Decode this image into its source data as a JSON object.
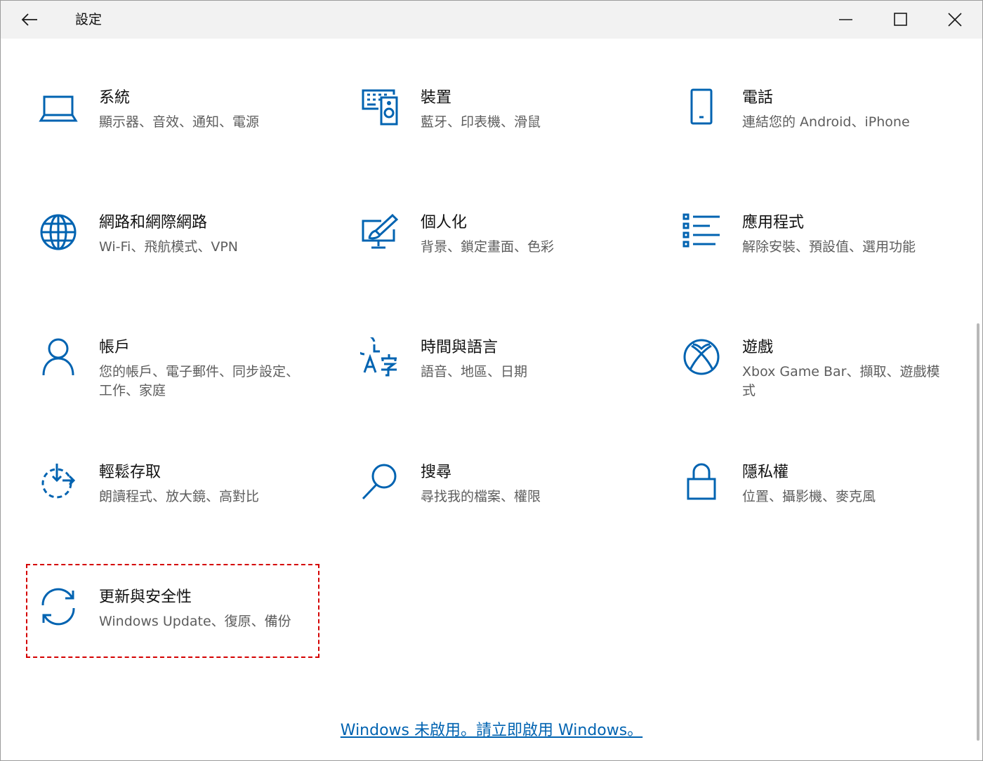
{
  "window": {
    "title": "設定",
    "accent_color": "#0063b1"
  },
  "titlebar": {
    "back_icon": "arrow-left-icon",
    "minimize_icon": "minimize-icon",
    "maximize_icon": "maximize-icon",
    "close_icon": "close-icon"
  },
  "categories": [
    {
      "title": "系統",
      "desc": "顯示器、音效、通知、電源",
      "icon": "laptop-icon"
    },
    {
      "title": "裝置",
      "desc": "藍牙、印表機、滑鼠",
      "icon": "keyboard-speaker-icon"
    },
    {
      "title": "電話",
      "desc": "連結您的 Android、iPhone",
      "icon": "phone-icon"
    },
    {
      "title": "網路和網際網路",
      "desc": "Wi-Fi、飛航模式、VPN",
      "icon": "globe-icon"
    },
    {
      "title": "個人化",
      "desc": "背景、鎖定畫面、色彩",
      "icon": "paint-monitor-icon"
    },
    {
      "title": "應用程式",
      "desc": "解除安裝、預設值、選用功能",
      "icon": "app-list-icon"
    },
    {
      "title": "帳戶",
      "desc": "您的帳戶、電子郵件、同步設定、工作、家庭",
      "icon": "person-icon"
    },
    {
      "title": "時間與語言",
      "desc": "語音、地區、日期",
      "icon": "time-language-icon"
    },
    {
      "title": "遊戲",
      "desc": "Xbox Game Bar、擷取、遊戲模式",
      "icon": "xbox-icon"
    },
    {
      "title": "輕鬆存取",
      "desc": "朗讀程式、放大鏡、高對比",
      "icon": "ease-of-access-icon"
    },
    {
      "title": "搜尋",
      "desc": "尋找我的檔案、權限",
      "icon": "search-icon"
    },
    {
      "title": "隱私權",
      "desc": "位置、攝影機、麥克風",
      "icon": "lock-icon"
    },
    {
      "title": "更新與安全性",
      "desc": "Windows Update、復原、備份",
      "icon": "sync-icon"
    }
  ],
  "activation": {
    "text": "Windows 未啟用。請立即啟用 Windows。"
  }
}
